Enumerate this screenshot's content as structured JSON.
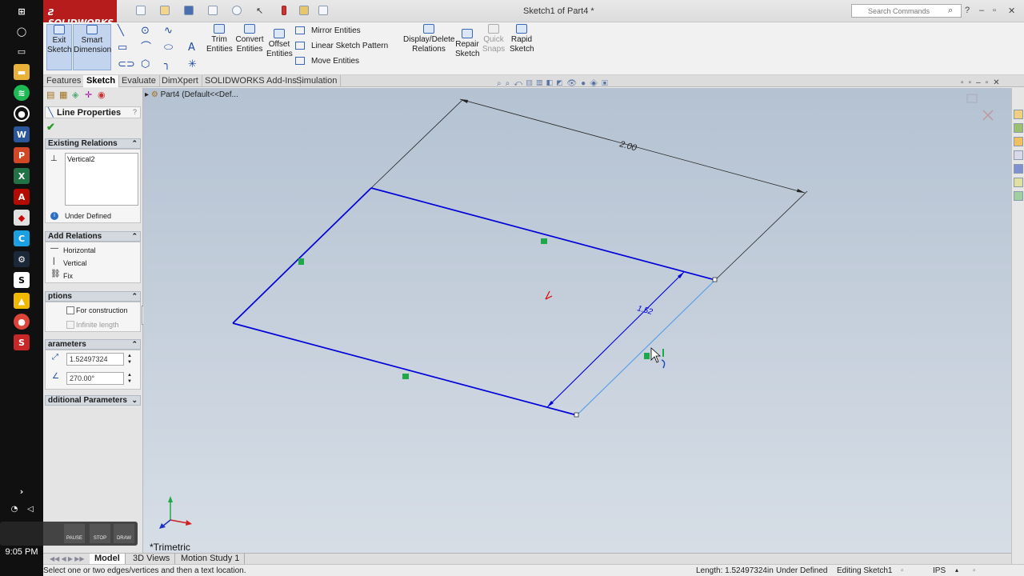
{
  "taskbar": {
    "icons": [
      "start-icon",
      "cortana-icon",
      "task-view-icon",
      "file-explorer-icon",
      "spotify-icon",
      "media-icon",
      "word-icon",
      "powerpoint-icon",
      "excel-icon",
      "acrobat-icon",
      "camtasia-icon",
      "steam-icon",
      "solidworks-icon",
      "ftp-icon",
      "chrome-icon",
      "solidworks-2016-icon"
    ],
    "clock": "9:05 PM"
  },
  "recorder": {
    "pause_label": "PAUSE",
    "stop_label": "STOP",
    "draw_label": "DRAW"
  },
  "window": {
    "logo_text": "SOLIDWORKS",
    "title": "Sketch1 of Part4 *",
    "search_placeholder": "Search Commands",
    "help": "?"
  },
  "ribbon": {
    "exit_sketch": [
      "Exit",
      "Sketch"
    ],
    "smart_dimension": [
      "Smart",
      "Dimension"
    ],
    "trim": [
      "Trim",
      "Entities"
    ],
    "convert": [
      "Convert",
      "Entities"
    ],
    "offset": [
      "Offset",
      "Entities"
    ],
    "mirror": "Mirror Entities",
    "linear_pattern": "Linear Sketch Pattern",
    "move": "Move Entities",
    "display_delete": [
      "Display/Delete",
      "Relations"
    ],
    "repair": [
      "Repair",
      "Sketch"
    ],
    "quick_snaps": [
      "Quick",
      "Snaps"
    ],
    "rapid": [
      "Rapid",
      "Sketch"
    ]
  },
  "tabs": [
    "Features",
    "Sketch",
    "Evaluate",
    "DimXpert",
    "SOLIDWORKS Add-Ins",
    "Simulation"
  ],
  "active_tab": "Sketch",
  "tree": {
    "breadcrumb": "Part4  (Default<<Def..."
  },
  "panel": {
    "title": "Line Properties",
    "help": "?",
    "existing_relations": {
      "header": "Existing Relations",
      "items": [
        "Vertical2"
      ],
      "status": "Under Defined"
    },
    "add_relations": {
      "header": "Add Relations",
      "items": [
        "Horizontal",
        "Vertical",
        "Fix"
      ]
    },
    "options": {
      "header": "ptions",
      "construction": "For construction",
      "infinite": "Infinite length"
    },
    "parameters": {
      "header": "arameters",
      "length": "1.52497324",
      "angle": "270.00°"
    },
    "additional": {
      "header": "dditional Parameters"
    }
  },
  "canvas": {
    "dim_top": "2.00",
    "dim_right": "1.52",
    "view_label": "*Trimetric",
    "sketch_color": "#0000d8",
    "dimension_color": "#000000",
    "highlight_color": "#5aa0e8",
    "relation_glyph_color": "#1ea84a"
  },
  "bottom_tabs": [
    "Model",
    "3D Views",
    "Motion Study 1"
  ],
  "status": {
    "prompt": "Select one or two edges/vertices and then a text location.",
    "length": "Length: 1.52497324in",
    "state": "Under Defined",
    "mode": "Editing Sketch1",
    "units": "IPS"
  }
}
